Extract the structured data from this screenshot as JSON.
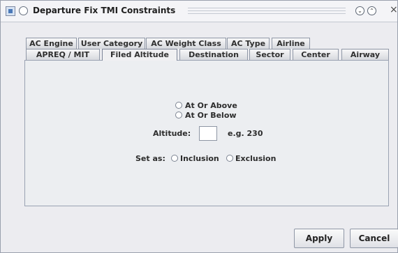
{
  "window": {
    "title": "Departure Fix TMI Constraints",
    "minimize_glyph": "⌄",
    "maximize_glyph": "⌃",
    "close_glyph": "×"
  },
  "tabs": {
    "back_row": [
      {
        "label": "AC Engine"
      },
      {
        "label": "User Category"
      },
      {
        "label": "AC Weight Class"
      },
      {
        "label": "AC Type"
      },
      {
        "label": "Airline"
      }
    ],
    "front_row": [
      {
        "label": "APREQ / MIT"
      },
      {
        "label": "Filed Altitude"
      },
      {
        "label": "Destination"
      },
      {
        "label": "Sector"
      },
      {
        "label": "Center"
      },
      {
        "label": "Airway"
      }
    ],
    "selected": "Filed Altitude"
  },
  "altitude_panel": {
    "option_at_or_above": "At Or Above",
    "option_at_or_below": "At Or Below",
    "altitude_label": "Altitude:",
    "altitude_value": "",
    "altitude_example": "e.g. 230",
    "set_as_label": "Set as:",
    "inclusion_label": "Inclusion",
    "exclusion_label": "Exclusion"
  },
  "buttons": {
    "apply": "Apply",
    "cancel": "Cancel"
  }
}
